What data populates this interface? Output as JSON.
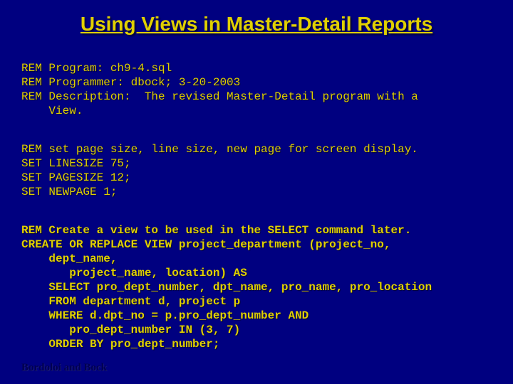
{
  "title": "Using Views in Master-Detail Reports",
  "block1": {
    "l1": "REM Program: ch9-4.sql",
    "l2": "REM Programmer: dbock; 3-20-2003",
    "l3": "REM Description:  The revised Master-Detail program with a",
    "l4": "    View."
  },
  "block2": {
    "l1": "REM set page size, line size, new page for screen display.",
    "l2": "SET LINESIZE 75;",
    "l3": "SET PAGESIZE 12;",
    "l4": "SET NEWPAGE 1;"
  },
  "block3": {
    "l1": "REM Create a view to be used in the SELECT command later.",
    "l2": "CREATE OR REPLACE VIEW project_department (project_no,",
    "l3": "    dept_name,",
    "l4": "       project_name, location) AS",
    "l5": "    SELECT pro_dept_number, dpt_name, pro_name, pro_location",
    "l6": "    FROM department d, project p",
    "l7": "    WHERE d.dpt_no = p.pro_dept_number AND",
    "l8": "       pro_dept_number IN (3, 7)",
    "l9": "    ORDER BY pro_dept_number;"
  },
  "footer": "Bordoloi and Bock"
}
